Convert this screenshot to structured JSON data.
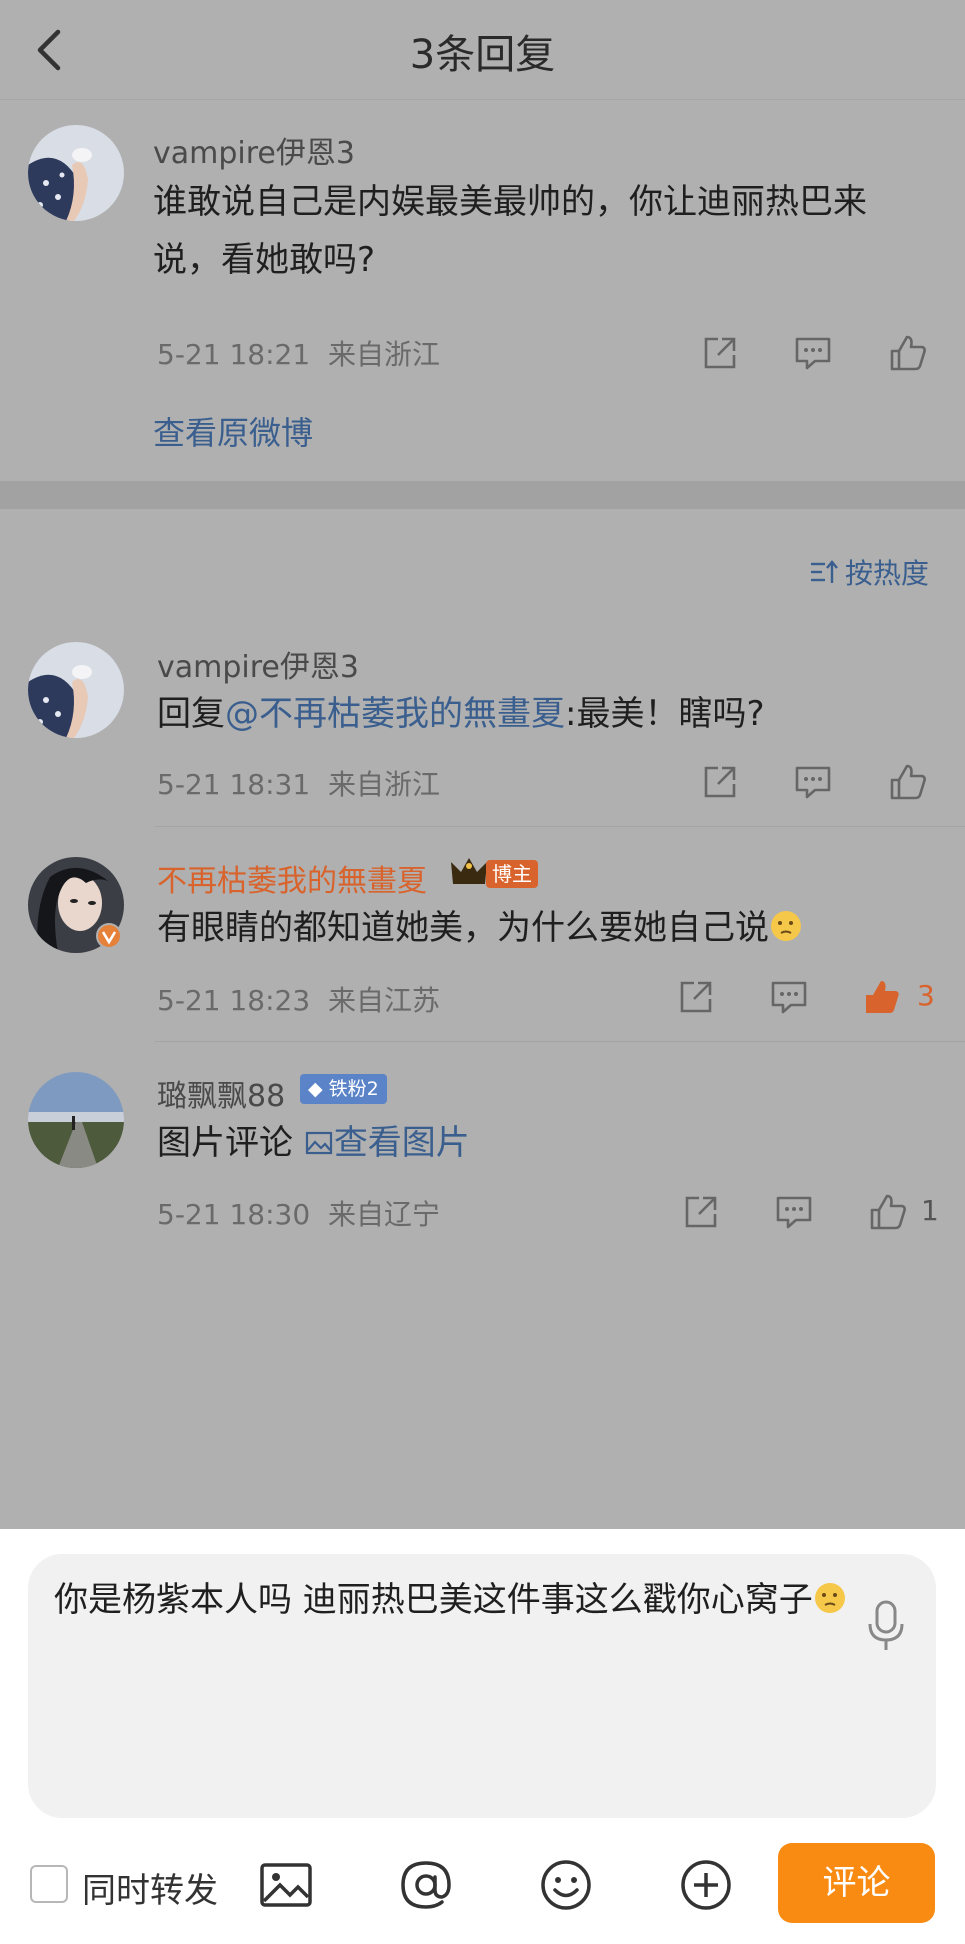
{
  "header": {
    "title": "3条回复"
  },
  "original": {
    "username": "vampire伊恩3",
    "text": "谁敢说自己是内娱最美最帅的，你让迪丽热巴来说，看她敢吗?",
    "time": "5-21 18:21",
    "location": "来自浙江",
    "view_original": "查看原微博"
  },
  "sort": {
    "label": "按热度"
  },
  "replies": [
    {
      "username": "vampire伊恩3",
      "prefix": "回复",
      "mention": "@不再枯萎我的無畫夏",
      "text": ":最美！瞎吗?",
      "time": "5-21 18:31",
      "location": "来自浙江",
      "likes": ""
    },
    {
      "username": "不再枯萎我的無畫夏",
      "badge": "博主",
      "text": "有眼睛的都知道她美，为什么要她自己说",
      "time": "5-21 18:23",
      "location": "来自江苏",
      "likes": "3"
    },
    {
      "username": "璐飘飘88",
      "badge": "铁粉2",
      "text": "图片评论",
      "image_link": "查看图片",
      "time": "5-21 18:30",
      "location": "来自辽宁",
      "likes": "1"
    }
  ],
  "compose": {
    "text": "你是杨紫本人吗 迪丽热巴美这件事这么戳你心窝子",
    "repost_label": "同时转发",
    "send_label": "评论"
  },
  "colors": {
    "accent": "#f98a12",
    "link": "#3a5f8f",
    "host": "#d9632c",
    "liked": "#d9632c"
  },
  "icons": [
    "back-icon",
    "share-icon",
    "comment-icon",
    "like-icon",
    "sort-icon",
    "mic-icon",
    "image-icon",
    "at-icon",
    "emoji-icon",
    "plus-icon",
    "verified-icon",
    "crown-icon"
  ]
}
